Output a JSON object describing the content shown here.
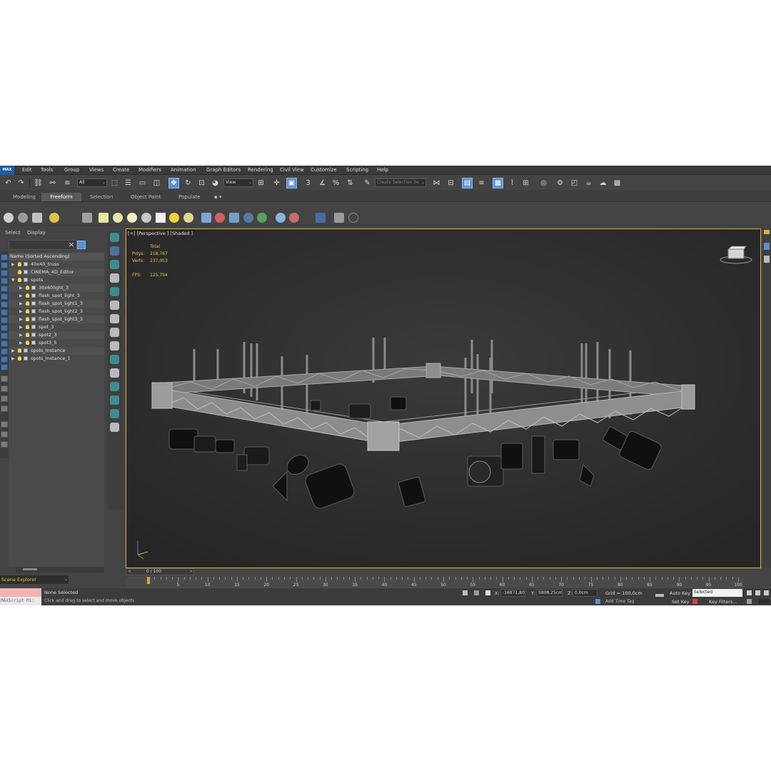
{
  "menu": {
    "logo": "MAX",
    "items": [
      "Edit",
      "Tools",
      "Group",
      "Views",
      "Create",
      "Modifiers",
      "Animation",
      "Graph Editors",
      "Rendering",
      "Civil View",
      "Customize",
      "Scripting",
      "Help"
    ]
  },
  "toolbar": {
    "filter_dropdown": "All",
    "view_dropdown": "View",
    "selection_set_placeholder": "Create Selection Se"
  },
  "ribbon": {
    "tabs": [
      "Modeling",
      "Freeform",
      "Selection",
      "Object Paint",
      "Populate"
    ],
    "active_tab": "Freeform"
  },
  "scene_explorer": {
    "tabs": [
      "Select",
      "Display"
    ],
    "column_header": "Name (Sorted Ascending)",
    "items": [
      {
        "label": "40x40_truss",
        "depth": 0,
        "expander": "▶",
        "icon": "light-bulb-icon"
      },
      {
        "label": "CINEMA_4D_Editor",
        "depth": 0,
        "expander": "",
        "icon": "camera-icon"
      },
      {
        "label": "spots",
        "depth": 0,
        "expander": "▼",
        "icon": "light-bulb-icon"
      },
      {
        "label": "30x60light_3",
        "depth": 1,
        "expander": "▶",
        "icon": "light-bulb-icon"
      },
      {
        "label": "flash_spot_light_3",
        "depth": 1,
        "expander": "▶",
        "icon": "light-bulb-icon"
      },
      {
        "label": "flash_spot_light1_3",
        "depth": 1,
        "expander": "▶",
        "icon": "light-bulb-icon"
      },
      {
        "label": "flash_spot_light2_3",
        "depth": 1,
        "expander": "▶",
        "icon": "light-bulb-icon"
      },
      {
        "label": "flash_spot_light3_3",
        "depth": 1,
        "expander": "▶",
        "icon": "light-bulb-icon"
      },
      {
        "label": "spot_3",
        "depth": 1,
        "expander": "▶",
        "icon": "light-bulb-icon"
      },
      {
        "label": "spot2_3",
        "depth": 1,
        "expander": "▶",
        "icon": "light-bulb-icon"
      },
      {
        "label": "spot3_5",
        "depth": 1,
        "expander": "▶",
        "icon": "light-bulb-icon"
      },
      {
        "label": "spots_Instance",
        "depth": 0,
        "expander": "▶",
        "icon": "light-bulb-icon"
      },
      {
        "label": "spots_Instance_1",
        "depth": 0,
        "expander": "▶",
        "icon": "light-bulb-icon"
      }
    ],
    "bottom_dropdown": "Scene Explorer"
  },
  "viewport": {
    "label": "[+] [Perspective ] [Shaded ]",
    "stats": {
      "total_label": "Total",
      "polys_label": "Polys:",
      "polys_value": "218,767",
      "verts_label": "Verts:",
      "verts_value": "237,053",
      "fps_label": "FPS:",
      "fps_value": "125,794"
    },
    "accent_border": "#d9b23a"
  },
  "timeline": {
    "slider_value": "0 / 100",
    "prev": "<",
    "next": ">",
    "ticks": [
      5,
      10,
      15,
      20,
      25,
      30,
      35,
      40,
      45,
      50,
      55,
      60,
      65,
      70,
      75,
      80,
      85,
      90,
      95,
      100
    ],
    "current_frame": 0,
    "max_frame": 100
  },
  "status": {
    "maxscript_label": "MAXScript Mi:",
    "main": "None Selected",
    "prompt": "Click and drag to select and move objects",
    "x_label": "X:",
    "x_value": "-16871,80",
    "y_label": "Y:",
    "y_value": "5808,25cm",
    "z_label": "Z:",
    "z_value": "0,0cm",
    "grid": "Grid = 100,0cm",
    "add_time_tag": "Add Time Tag",
    "auto_key": "Auto Key",
    "auto_key_mode": "Selected",
    "set_key": "Set Key",
    "key_filters": "Key Filters..."
  },
  "colors": {
    "accent_blue": "#5b8fd0",
    "stats_yellow": "#e2c44b",
    "maxscript_pink": "#f2b3b3"
  }
}
